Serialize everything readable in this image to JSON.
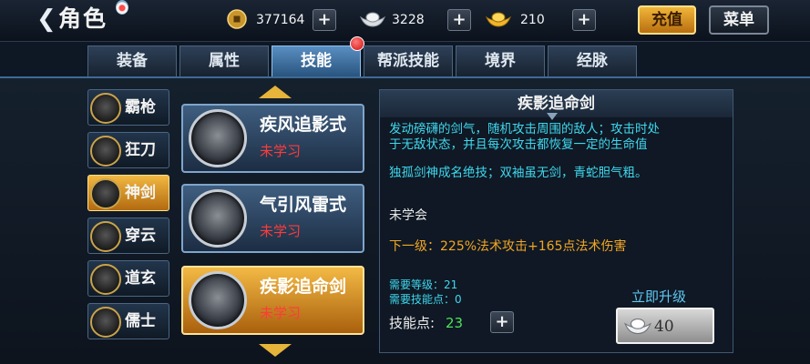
{
  "header": {
    "title": "角色",
    "recharge_label": "充值",
    "menu_label": "菜单",
    "currencies": [
      {
        "icon": "copper-coin-icon",
        "value": "377164"
      },
      {
        "icon": "silver-ingot-icon",
        "value": "3228"
      },
      {
        "icon": "gold-ingot-icon",
        "value": "210"
      }
    ]
  },
  "tabs": [
    {
      "label": "装备",
      "active": false
    },
    {
      "label": "属性",
      "active": false
    },
    {
      "label": "技能",
      "active": true,
      "badge": true
    },
    {
      "label": "帮派技能",
      "active": false
    },
    {
      "label": "境界",
      "active": false
    },
    {
      "label": "经脉",
      "active": false
    }
  ],
  "categories": [
    {
      "label": "霸枪",
      "icon": "spear-icon",
      "active": false
    },
    {
      "label": "狂刀",
      "icon": "blade-icon",
      "active": false
    },
    {
      "label": "神剑",
      "icon": "sword-icon",
      "active": true
    },
    {
      "label": "穿云",
      "icon": "bow-icon",
      "active": false
    },
    {
      "label": "道玄",
      "icon": "taoist-icon",
      "active": false
    },
    {
      "label": "儒士",
      "icon": "fan-icon",
      "active": false
    }
  ],
  "skills": [
    {
      "name": "疾风追影式",
      "status": "未学习",
      "active": false
    },
    {
      "name": "气引风雷式",
      "status": "未学习",
      "active": false
    },
    {
      "name": "疾影追命剑",
      "status": "未学习",
      "active": true
    }
  ],
  "detail": {
    "title": "疾影追命剑",
    "description": "发动磅礴的剑气，随机攻击周围的敌人；攻击时处于无敌状态，并且每次攻击都恢复一定的生命值",
    "lore": "独孤剑神成名绝技；双袖虽无剑，青蛇胆气粗。",
    "learn_status": "未学会",
    "next_level": "下一级：225%法术攻击+165点法术伤害",
    "required_level": "需要等级：21",
    "required_points": "需要技能点：0",
    "skill_points_label": "技能点:",
    "skill_points_value": "23",
    "upgrade_label": "立即升级",
    "upgrade_cost": "40"
  },
  "colors": {
    "accent_gold": "#f2b842",
    "active_tab": "#5a8fc2",
    "description_cyan": "#3fd8ee",
    "unlearned_red": "#ff3b3b",
    "next_level_orange": "#f2a623",
    "points_green": "#4ee35a"
  }
}
